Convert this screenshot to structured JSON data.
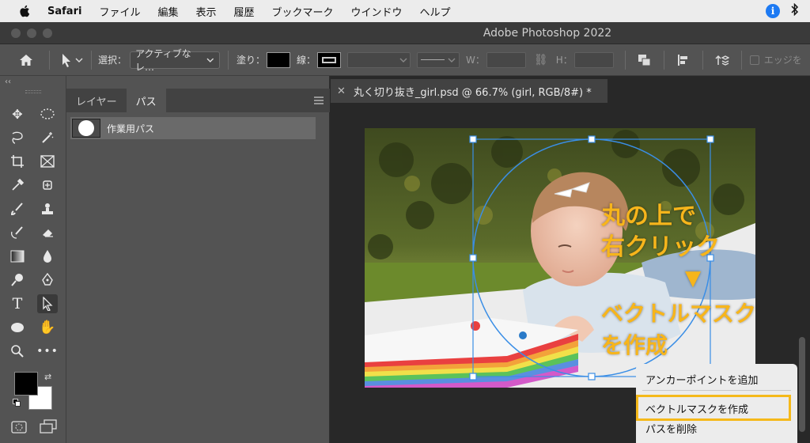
{
  "menubar": {
    "app": "Safari",
    "items": [
      "ファイル",
      "編集",
      "表示",
      "履歴",
      "ブックマーク",
      "ウインドウ",
      "ヘルプ"
    ]
  },
  "window": {
    "title": "Adobe Photoshop 2022"
  },
  "options_bar": {
    "select_label": "選択：",
    "select_value": "アクティブなレ…",
    "fill_label": "塗り：",
    "stroke_label": "線：",
    "w_label": "W：",
    "h_label": "H：",
    "edge_label": "エッジを"
  },
  "panel": {
    "tabs": [
      "レイヤー",
      "パス"
    ],
    "active_tab": "パス",
    "paths": [
      {
        "name": "作業用パス"
      }
    ]
  },
  "document": {
    "tab_title": "丸く切り抜き_girl.psd @ 66.7% (girl, RGB/8#) *"
  },
  "annotation": {
    "line1": "丸の上で",
    "line2": "右クリック",
    "arrow": "▼",
    "line3": "ベクトルマスク",
    "line4": "を作成"
  },
  "context_menu": {
    "items": [
      "アンカーポイントを追加",
      "ベクトルマスクを作成",
      "パスを削除"
    ],
    "highlighted": "ベクトルマスクを作成"
  },
  "colors": {
    "accent_highlight": "#f5b91a",
    "path_stroke": "#3a8ee6"
  }
}
